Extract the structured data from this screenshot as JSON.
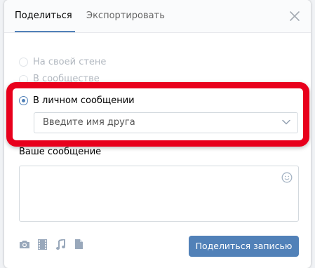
{
  "tabs": [
    {
      "label": "Поделиться",
      "active": true
    },
    {
      "label": "Экспортировать",
      "active": false
    }
  ],
  "options": [
    {
      "label": "На своей стене",
      "checked": false
    },
    {
      "label": "В сообществе",
      "checked": false
    },
    {
      "label": "В личном сообщении",
      "checked": true
    }
  ],
  "friend_select": {
    "placeholder": "Введите имя друга"
  },
  "message": {
    "label": "Ваше сообщение",
    "value": ""
  },
  "attachments": [
    "camera-icon",
    "video-icon",
    "music-icon",
    "document-icon"
  ],
  "share_button": {
    "label": "Поделиться записью"
  },
  "colors": {
    "accent": "#5181b8",
    "highlight": "#e8001c"
  }
}
